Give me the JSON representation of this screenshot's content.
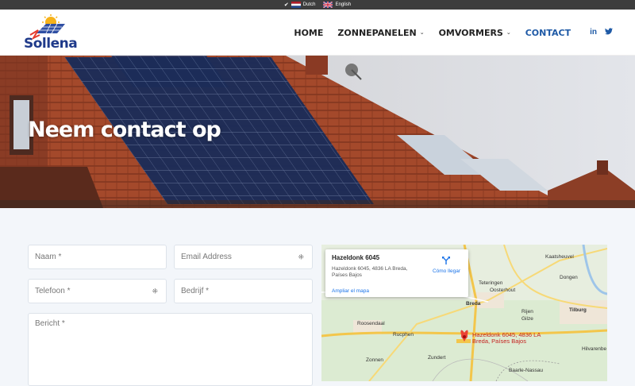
{
  "topbar": {
    "languages": [
      {
        "label": "Dutch",
        "active": true
      },
      {
        "label": "English",
        "active": false
      }
    ]
  },
  "header": {
    "logo_text": "Sollena",
    "nav": [
      {
        "label": "HOME",
        "dropdown": false,
        "active": false
      },
      {
        "label": "ZONNEPANELEN",
        "dropdown": true,
        "active": false
      },
      {
        "label": "OMVORMERS",
        "dropdown": true,
        "active": false
      },
      {
        "label": "CONTACT",
        "dropdown": false,
        "active": true
      }
    ],
    "social": [
      "linkedin-icon",
      "twitter-icon"
    ]
  },
  "hero": {
    "title": "Neem contact op"
  },
  "form": {
    "name_placeholder": "Naam *",
    "email_placeholder": "Email Address",
    "phone_placeholder": "Telefoon *",
    "company_placeholder": "Bedrijf *",
    "message_placeholder": "Bericht *"
  },
  "map": {
    "card_title": "Hazeldonk 6045",
    "card_address": "Hazeldonk 6045, 4836 LA Breda, Países Bajos",
    "card_link": "Ampliar el mapa",
    "directions_label": "Cómo llegar",
    "pin_label": "Hazeldonk 6045, 4836 LA Breda, Países Bajos",
    "towns": [
      "Breda",
      "Tilburg",
      "Roosendaal",
      "Rucphen",
      "Zundert",
      "Oosterhout",
      "Teteringen",
      "Gilze",
      "Rijen",
      "Zonnen",
      "Baarle-Nassau",
      "Kaatsheuvel",
      "Dongen",
      "Hilvarenbe"
    ]
  },
  "colors": {
    "brand_blue": "#1f5aa6",
    "topbar": "#3d3d3d",
    "pin": "#c5221f"
  }
}
